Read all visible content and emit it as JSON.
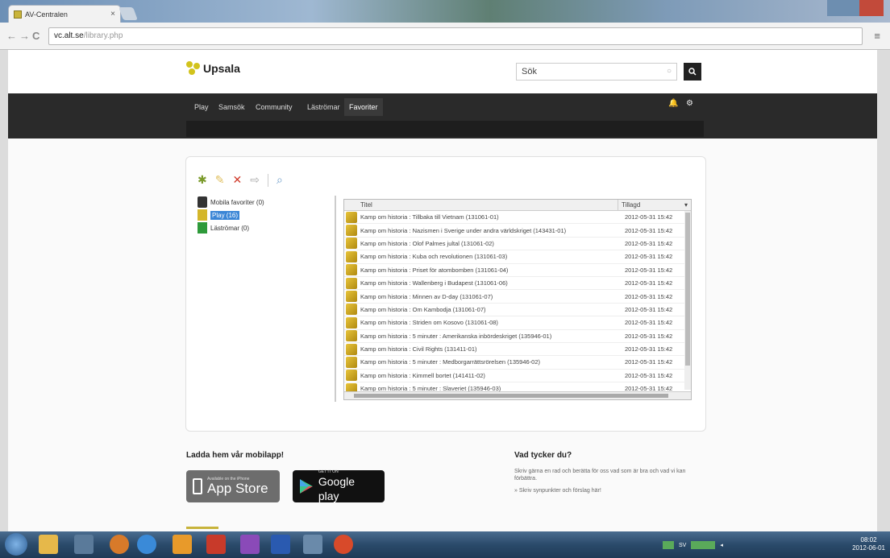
{
  "browser": {
    "tab_title": "AV-Centralen",
    "tab_close": "×",
    "url_host": "vc.alt.se",
    "url_path": "/library.php",
    "back": "←",
    "forward": "→",
    "reload": "C",
    "menu": "≡"
  },
  "site": {
    "logo_text": "Upsala",
    "search_value": "Sök",
    "search_clear": "○",
    "search_button": "Q",
    "nav": [
      {
        "label": "Play"
      },
      {
        "label": "Samsök"
      },
      {
        "label": "Community"
      },
      {
        "label": "Läströmar"
      },
      {
        "label": "Favoriter"
      }
    ],
    "active_nav": "Favoriter",
    "nav_icons": [
      "bell-icon",
      "gear-icon"
    ]
  },
  "toolbar": {
    "icons": [
      "add-folder-icon",
      "edit-icon",
      "delete-icon",
      "move-icon",
      "search-icon"
    ]
  },
  "tree": {
    "items": [
      {
        "label": "Mobila favoriter (0)",
        "selected": false,
        "icon": "phone-icon"
      },
      {
        "label": "Play (16)",
        "selected": true,
        "icon": "folder-icon"
      },
      {
        "label": "Läströmar (0)",
        "selected": false,
        "icon": "book-icon"
      }
    ]
  },
  "grid": {
    "col_title": "Titel",
    "col_date": "Tillagd",
    "sort_indicator": "▾",
    "rows": [
      {
        "title": "Kamp om historia : Tillbaka till Vietnam (131061-01)",
        "date": "2012-05-31 15:42"
      },
      {
        "title": "Kamp om historia : Nazismen i Sverige under andra världskriget (143431-01)",
        "date": "2012-05-31 15:42"
      },
      {
        "title": "Kamp om historia : Olof Palmes jultal (131061-02)",
        "date": "2012-05-31 15:42"
      },
      {
        "title": "Kamp om historia : Kuba och revolutionen (131061-03)",
        "date": "2012-05-31 15:42"
      },
      {
        "title": "Kamp om historia : Priset för atombomben (131061-04)",
        "date": "2012-05-31 15:42"
      },
      {
        "title": "Kamp om historia : Wallenberg i Budapest (131061-06)",
        "date": "2012-05-31 15:42"
      },
      {
        "title": "Kamp om historia : Minnen av D-day (131061-07)",
        "date": "2012-05-31 15:42"
      },
      {
        "title": "Kamp om historia : Om Kambodja (131061-07)",
        "date": "2012-05-31 15:42"
      },
      {
        "title": "Kamp om historia : Striden om Kosovo (131061-08)",
        "date": "2012-05-31 15:42"
      },
      {
        "title": "Kamp om historia : 5 minuter : Amerikanska inbördeskriget (135946-01)",
        "date": "2012-05-31 15:42"
      },
      {
        "title": "Kamp om historia : Civil Rights (131411-01)",
        "date": "2012-05-31 15:42"
      },
      {
        "title": "Kamp om historia : 5 minuter : Medborgarrättsrörelsen (135946-02)",
        "date": "2012-05-31 15:42"
      },
      {
        "title": "Kamp om historia : Kimmell bortet (141411-02)",
        "date": "2012-05-31 15:42"
      },
      {
        "title": "Kamp om historia : 5 minuter : Slaveriet (135946-03)",
        "date": "2012-05-31 15:42"
      }
    ]
  },
  "footer": {
    "app_heading": "Ladda hem vår mobilapp!",
    "appstore_small": "Available on the iPhone",
    "appstore_big": "App Store",
    "gplay_small": "GET IT ON",
    "gplay_big": "Google play",
    "feedback_heading": "Vad tycker du?",
    "feedback_text": "Skriv gärna en rad och berätta för oss vad som är bra och vad vi kan förbättra.",
    "feedback_link": "» Skriv synpunkter och förslag här!"
  },
  "taskbar": {
    "clock_time": "08:02",
    "clock_date": "2012-06-01",
    "tray_label": "SV"
  },
  "colors": {
    "navbar": "#2a2a2a",
    "logo_accent": "#d2c31c",
    "selected": "#3b86d6"
  }
}
